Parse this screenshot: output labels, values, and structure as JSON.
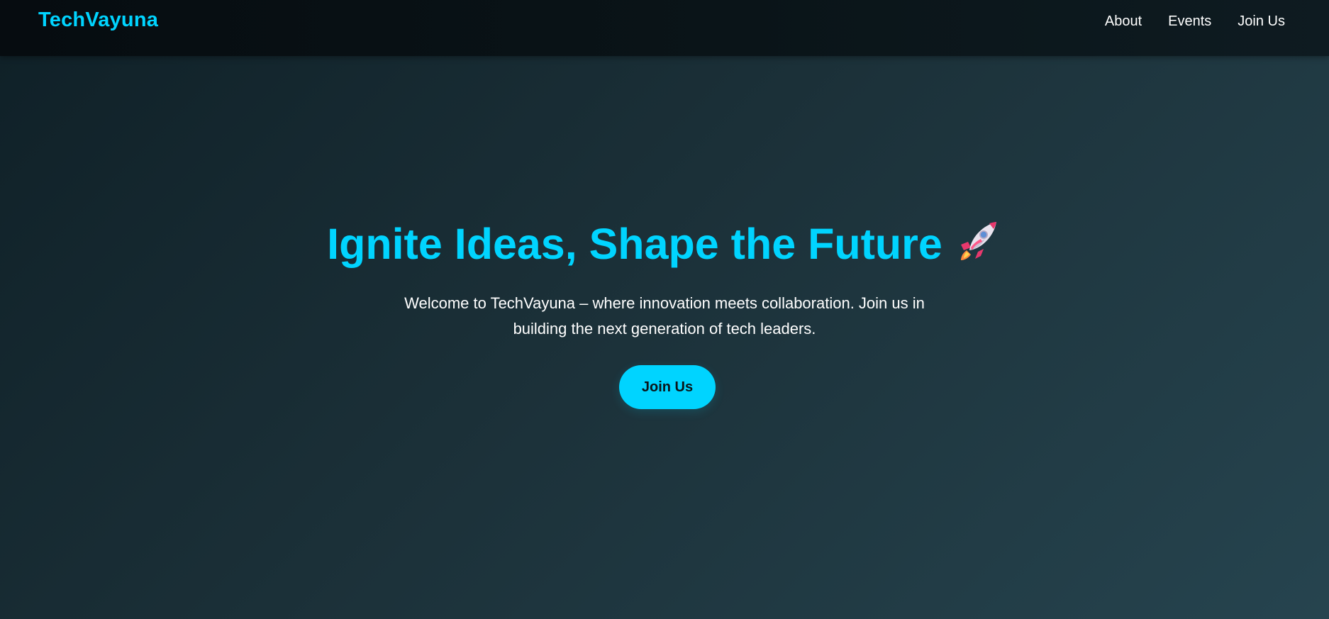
{
  "navbar": {
    "brand": "TechVayuna",
    "links": [
      {
        "label": "About"
      },
      {
        "label": "Events"
      },
      {
        "label": "Join Us"
      }
    ]
  },
  "hero": {
    "title": "Ignite Ideas, Shape the Future",
    "title_icon": "rocket-icon",
    "subtitle": "Welcome to TechVayuna – where innovation meets collaboration. Join us in building the next generation of tech leaders.",
    "cta_label": "Join Us"
  },
  "colors": {
    "accent": "#00d4ff",
    "text": "#ffffff",
    "background_start": "#0f2027",
    "background_end": "#26444f"
  }
}
